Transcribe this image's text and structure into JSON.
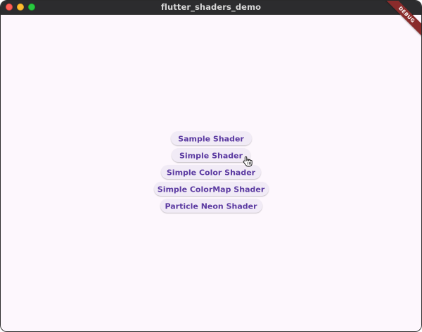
{
  "window": {
    "title": "flutter_shaders_demo"
  },
  "debug_banner": {
    "label": "DEBUG"
  },
  "buttons": [
    {
      "label": "Sample Shader"
    },
    {
      "label": "Simple Shader"
    },
    {
      "label": "Simple Color Shader"
    },
    {
      "label": "Simple ColorMap Shader"
    },
    {
      "label": "Particle Neon Shader"
    }
  ],
  "colors": {
    "background": "#fdf7fd",
    "button_background": "#f1ebf6",
    "button_text": "#5b3aa1",
    "titlebar": "#2c2c2e",
    "debug_ribbon": "#8a2b2b"
  },
  "cursor": {
    "icon": "hand-pointer-icon"
  }
}
